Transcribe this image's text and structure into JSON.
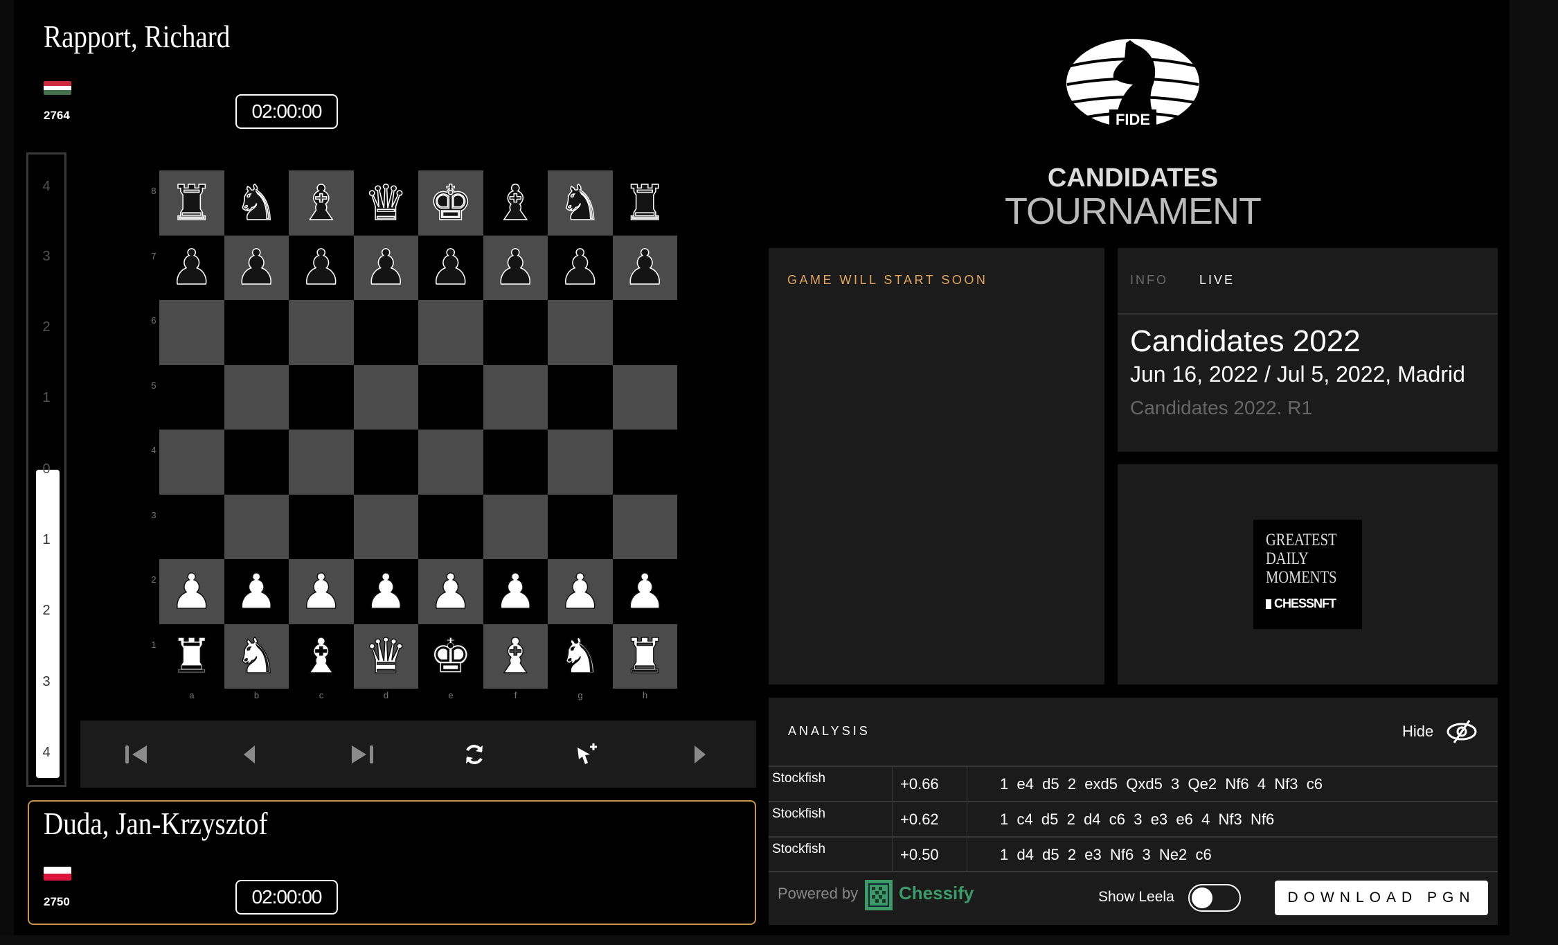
{
  "top_player": {
    "name": "Rapport, Richard",
    "rating": "2764",
    "clock": "02:00:00",
    "flag_colors": [
      "#cd2a3e",
      "#ffffff",
      "#436f4d"
    ]
  },
  "bottom_player": {
    "name": "Duda, Jan-Krzysztof",
    "rating": "2750",
    "clock": "02:00:00",
    "flag_colors": [
      "#ffffff",
      "#dc143c"
    ]
  },
  "eval_bar": {
    "labels_top": [
      "4",
      "3",
      "2",
      "1"
    ],
    "zero": "0",
    "labels_bottom": [
      "1",
      "2",
      "3",
      "4"
    ],
    "white_share": 0.5
  },
  "board": {
    "ranks": [
      "8",
      "7",
      "6",
      "5",
      "4",
      "3",
      "2",
      "1"
    ],
    "files": [
      "a",
      "b",
      "c",
      "d",
      "e",
      "f",
      "g",
      "h"
    ],
    "position": [
      "rnbqkbnr",
      "pppppppp",
      "........",
      "........",
      "........",
      "........",
      "PPPPPPPP",
      "RNBQKBNR"
    ]
  },
  "controls": [
    {
      "name": "first-move",
      "icon": "skip-back-icon"
    },
    {
      "name": "previous-move",
      "icon": "triangle-left-icon"
    },
    {
      "name": "last-move",
      "icon": "skip-forward-icon"
    },
    {
      "name": "flip-board",
      "icon": "rotate-icon"
    },
    {
      "name": "add-move",
      "icon": "cursor-plus-icon"
    },
    {
      "name": "next-move",
      "icon": "triangle-right-icon"
    }
  ],
  "logo": {
    "fide": "FIDE",
    "line1": "CANDIDATES",
    "line2": "TOURNAMENT"
  },
  "game_panel": {
    "status": "GAME WILL START SOON"
  },
  "info_panel": {
    "tabs": [
      {
        "label": "INFO",
        "active": false
      },
      {
        "label": "LIVE",
        "active": true
      }
    ],
    "title": "Candidates 2022",
    "dates": "Jun 16, 2022 / Jul 5, 2022, Madrid",
    "round": "Candidates 2022. R1"
  },
  "ad": {
    "lines": [
      "GREATEST",
      "DAILY",
      "MOMENTS"
    ],
    "brand": "CHESSNFT"
  },
  "analysis": {
    "title": "ANALYSIS",
    "hide_label": "Hide",
    "lines": [
      {
        "engine": "Stockfish",
        "eval": "+0.66",
        "moves": "1  e4  d5  2  exd5  Qxd5  3  Qe2  Nf6  4  Nf3  c6"
      },
      {
        "engine": "Stockfish",
        "eval": "+0.62",
        "moves": "1  c4  d5  2  d4  c6  3  e3  e6  4  Nf3  Nf6"
      },
      {
        "engine": "Stockfish",
        "eval": "+0.50",
        "moves": "1  d4  d5  2  e3  Nf6  3  Ne2  c6"
      }
    ],
    "powered_by": "Powered by",
    "provider": "Chessify",
    "provider_color": "#3c9a68",
    "show_leela": "Show Leela",
    "show_leela_on": false,
    "download": "DOWNLOAD PGN"
  },
  "colors": {
    "accent": "#e0a35e",
    "panel": "#1b1b1b",
    "light_square": "#4b4b4b",
    "dark_square": "#000000"
  }
}
